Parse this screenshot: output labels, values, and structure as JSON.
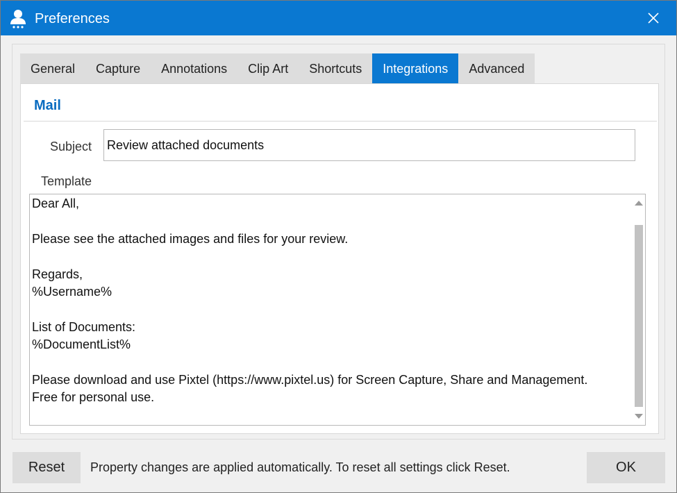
{
  "window": {
    "title": "Preferences",
    "icon": "user-icon",
    "close_icon": "close-icon",
    "accent_color": "#0a78d1"
  },
  "tabs": [
    {
      "label": "General",
      "active": false
    },
    {
      "label": "Capture",
      "active": false
    },
    {
      "label": "Annotations",
      "active": false
    },
    {
      "label": "Clip Art",
      "active": false
    },
    {
      "label": "Shortcuts",
      "active": false
    },
    {
      "label": "Integrations",
      "active": true
    },
    {
      "label": "Advanced",
      "active": false
    }
  ],
  "mail": {
    "section_title": "Mail",
    "subject_label": "Subject",
    "subject_value": "Review attached documents",
    "template_label": "Template",
    "template_value": "Dear All,\n\nPlease see the attached images and files for your review.\n\nRegards,\n%Username%\n\nList of Documents:\n%DocumentList%\n\nPlease download and use Pixtel (https://www.pixtel.us) for Screen Capture, Share and Management.\nFree for personal use."
  },
  "footer": {
    "reset_label": "Reset",
    "note": "Property changes are applied automatically. To reset all settings click Reset.",
    "ok_label": "OK"
  }
}
